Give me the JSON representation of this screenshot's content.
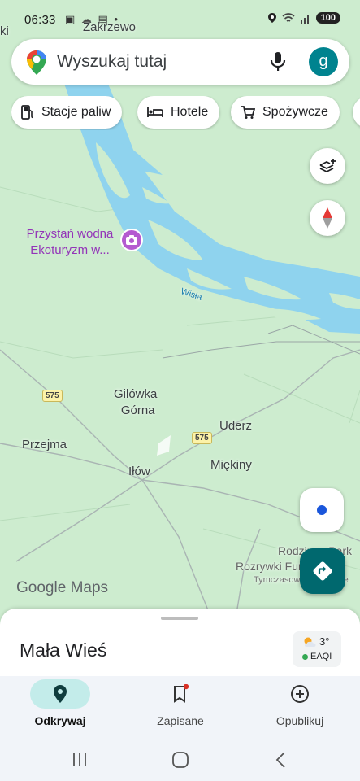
{
  "status_bar": {
    "time": "06:33",
    "battery": "100"
  },
  "search": {
    "placeholder": "Wyszukaj tutaj",
    "avatar_letter": "g"
  },
  "chips": [
    {
      "label": "Stacje paliw",
      "icon": "fuel-icon"
    },
    {
      "label": "Hotele",
      "icon": "bed-icon"
    },
    {
      "label": "Spożywcze",
      "icon": "cart-icon"
    }
  ],
  "map": {
    "labels": {
      "zakrzewo": "Zakrzewo",
      "left_edge": "ki",
      "river": "Wisła",
      "gilowka_1": "Gilówka",
      "gilowka_2": "Górna",
      "uderz": "Uderz",
      "przejma": "Przejma",
      "ilow": "Iłów",
      "miekiny": "Miękiny",
      "rodzinny_1": "Rodzinny Park",
      "rodzinny_2": "Rozrywki Fun Media",
      "rodzinny_3": "Tymczasowo zamknięte"
    },
    "poi": {
      "line1": "Przystań wodna",
      "line2": "Ekoturyzm w..."
    },
    "road_numbers": [
      "575",
      "575"
    ],
    "logo": {
      "google": "Google",
      "maps": "Maps"
    }
  },
  "sheet": {
    "place": "Mała Wieś",
    "temperature": "3°",
    "air_quality": "EAQI"
  },
  "bottom_nav": [
    {
      "label": "Odkrywaj",
      "icon": "explore-pin-icon",
      "active": true
    },
    {
      "label": "Zapisane",
      "icon": "bookmark-icon",
      "active": false
    },
    {
      "label": "Opublikuj",
      "icon": "add-circle-icon",
      "active": false
    }
  ],
  "colors": {
    "map_land": "#cdeccf",
    "river": "#8fd3ee",
    "accent_teal": "#00686e",
    "poi_purple": "#9334b8",
    "location_blue": "#1a56db"
  }
}
